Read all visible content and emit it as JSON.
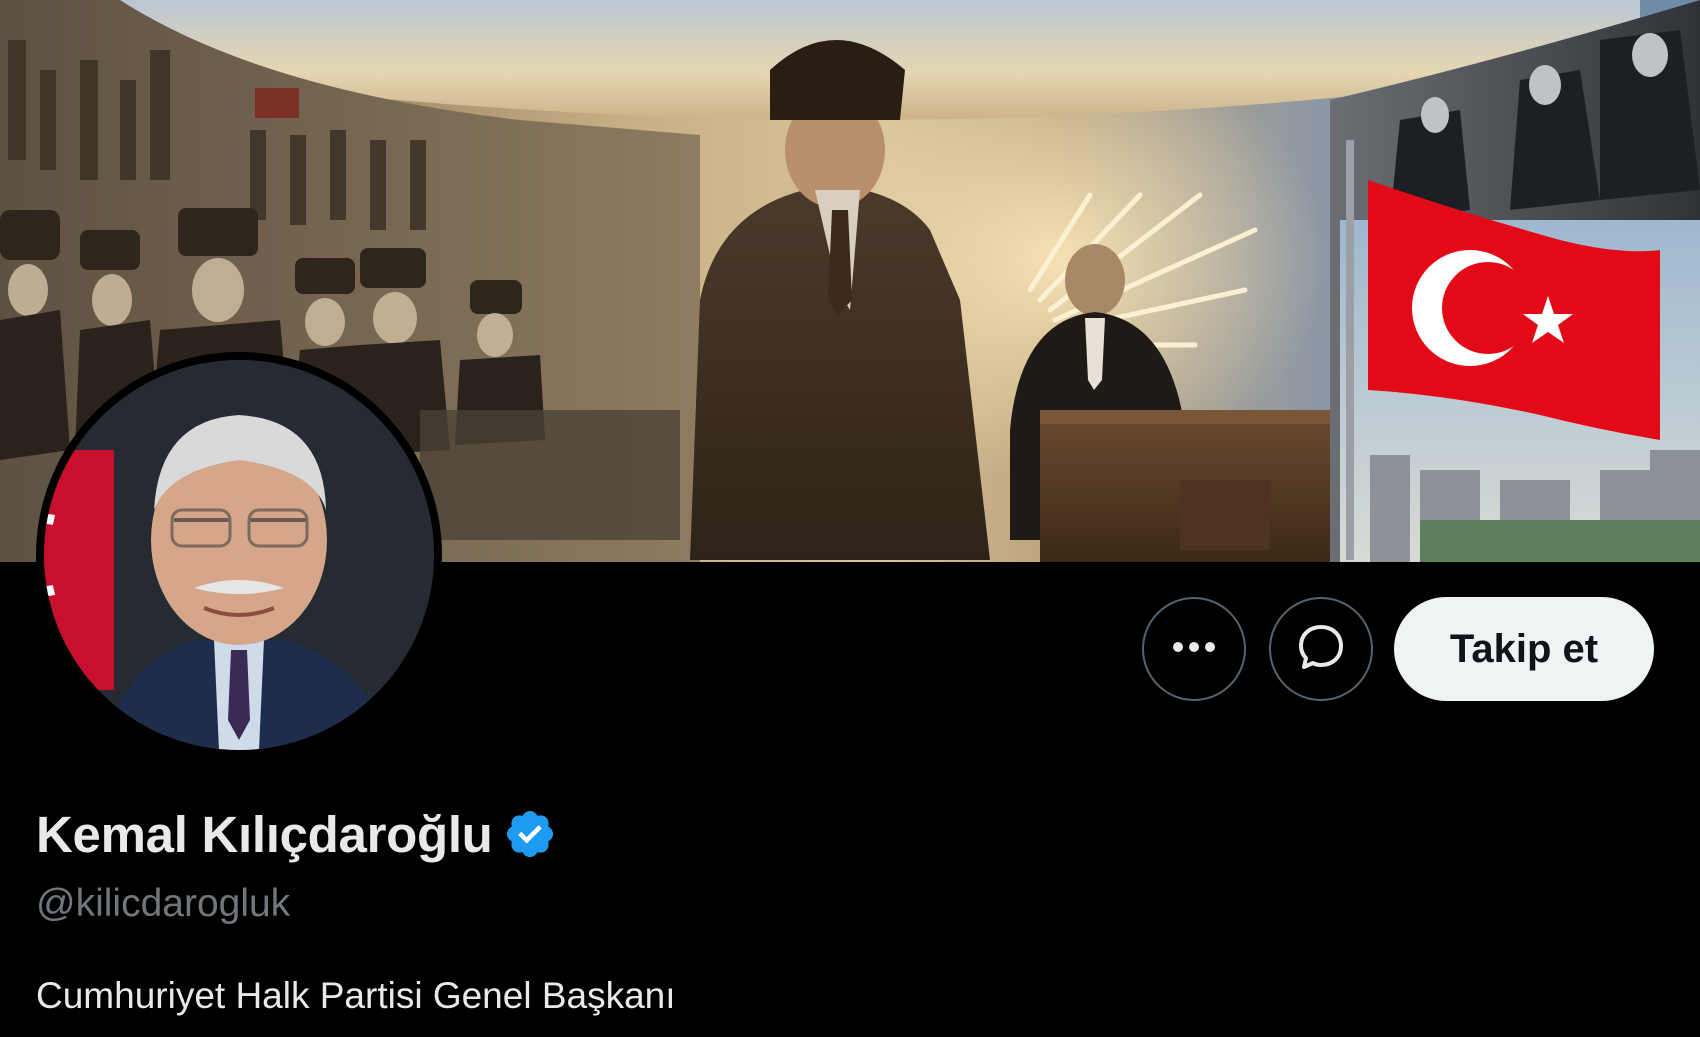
{
  "profile": {
    "display_name": "Kemal Kılıçdaroğlu",
    "verified": true,
    "handle": "@kilicdarogluk",
    "bio": "Cumhuriyet Halk Partisi Genel Başkanı"
  },
  "actions": {
    "more_icon": "more-horizontal-icon",
    "message_icon": "message-bubble-icon",
    "follow_label": "Takip et"
  },
  "colors": {
    "background": "#000000",
    "verified_badge": "#1d9bf0",
    "follow_button_bg": "#eff3f4",
    "handle_text": "#71767b",
    "flag_red": "#e30a17"
  }
}
